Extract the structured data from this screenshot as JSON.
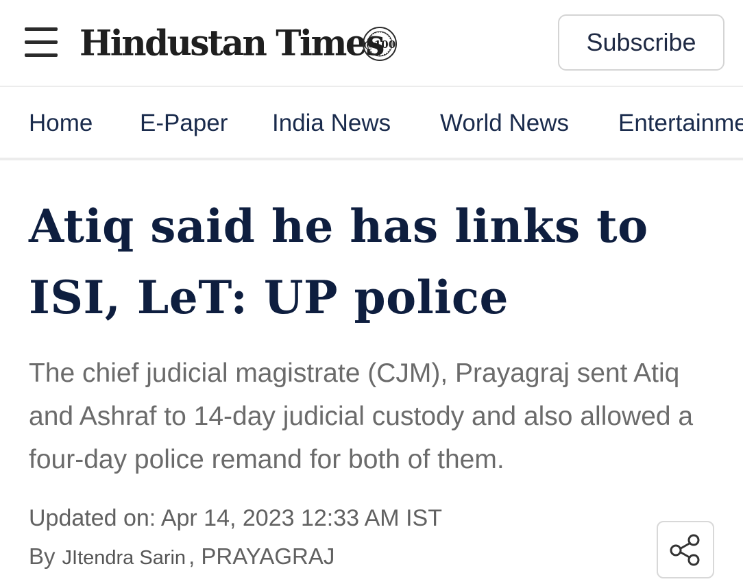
{
  "header": {
    "logo_text": "Hindustan Times",
    "logo_badge": "@100",
    "subscribe_label": "Subscribe",
    "menu_icon": "hamburger-menu-icon"
  },
  "nav": {
    "items": [
      {
        "label": "Home"
      },
      {
        "label": "E-Paper"
      },
      {
        "label": "India News"
      },
      {
        "label": "World News"
      },
      {
        "label": "Entertainment"
      }
    ]
  },
  "article": {
    "headline": "Atiq said he has links to ISI, LeT: UP police",
    "summary": "The chief judicial magistrate (CJM), Prayagraj sent Atiq and Ashraf to 14-day judicial custody and also allowed a four-day police remand for both of them.",
    "updated": "Updated on: Apr 14, 2023 12:33 AM IST",
    "by_label": "By",
    "author": "JItendra Sarin",
    "location": ", PRAYAGRAJ",
    "share_icon": "share-icon"
  },
  "colors": {
    "headline": "#0e1e3f",
    "nav_text": "#1a2b4c",
    "summary_text": "#6b6b6b",
    "meta_text": "#616161"
  }
}
